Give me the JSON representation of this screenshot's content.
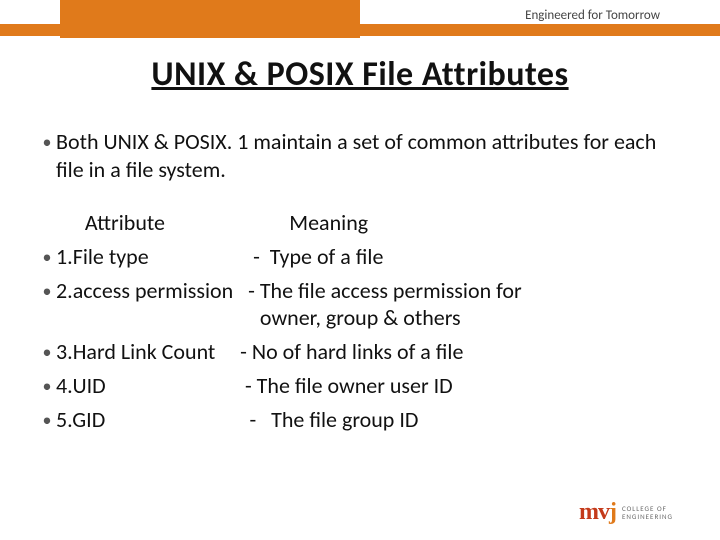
{
  "tagline": "Engineered for Tomorrow",
  "title": "UNIX & POSIX File Attributes",
  "intro": "Both UNIX & POSIX. 1 maintain a set of common attributes for each file in a file system.",
  "col_header": "   Attribute                         Meaning",
  "rows": [
    "1.File type                     -  Type of a file",
    "2.access permission   - The file access permission for\n                                         owner, group & others",
    "3.Hard Link Count     - No of hard links of a file",
    "4.UID                            - The file owner user ID",
    "5.GID                             -   The file group ID"
  ],
  "logo": {
    "mark_left": "mv",
    "mark_right": "j",
    "text": "COLLEGE OF ENGINEERING"
  }
}
